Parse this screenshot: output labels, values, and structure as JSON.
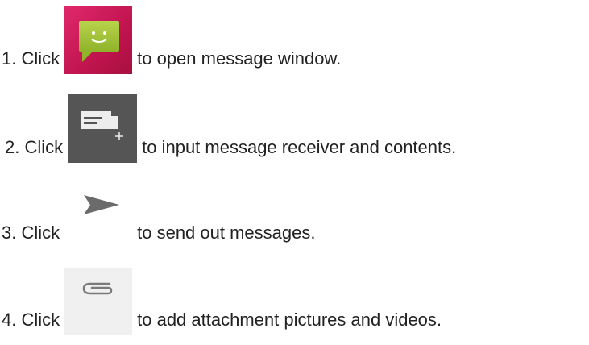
{
  "steps": [
    {
      "prefix": "1. Click",
      "text": "to open message window.",
      "icon": "message-app-icon"
    },
    {
      "prefix": "2. Click",
      "text": "to input message receiver and contents.",
      "icon": "compose-message-icon"
    },
    {
      "prefix": "3. Click",
      "text": "to send out messages.",
      "icon": "send-icon"
    },
    {
      "prefix": "4. Click",
      "text": "to add attachment pictures and videos.",
      "icon": "paperclip-icon"
    }
  ],
  "colors": {
    "text": "#222222",
    "message_icon_bg": "#d01e5c",
    "message_bubble": "#a6c83c",
    "compose_bg": "#555555",
    "send_arrow": "#666666",
    "attach_bg": "#f0f0f0"
  }
}
